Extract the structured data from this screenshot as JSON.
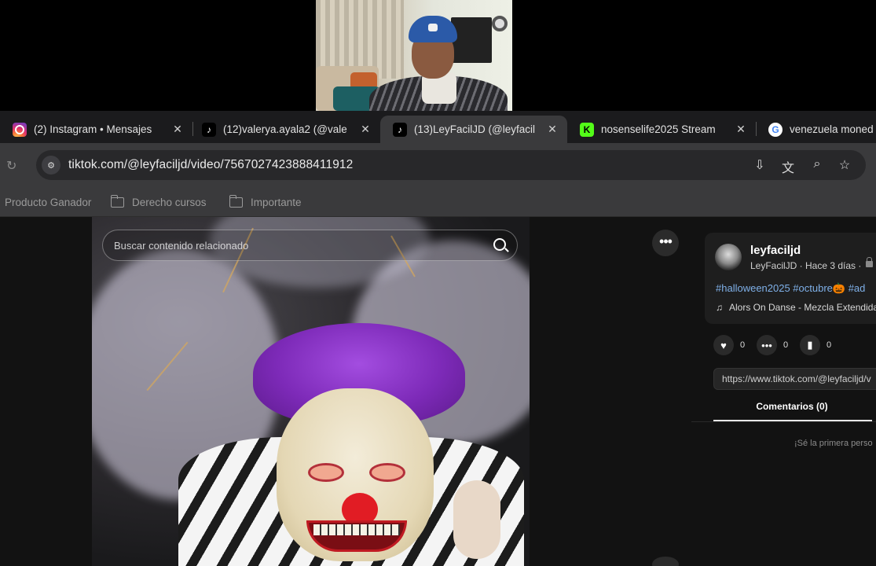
{
  "tabs": [
    {
      "title": "(2) Instagram • Mensajes",
      "favicon": "instagram-icon",
      "active": false
    },
    {
      "title": "(12)valerya.ayala2 (@vale",
      "favicon": "tiktok-icon",
      "active": false
    },
    {
      "title": "(13)LeyFacilJD (@leyfacil",
      "favicon": "tiktok-icon",
      "active": true
    },
    {
      "title": "nosenselife2025 Stream",
      "favicon": "kick-icon",
      "active": false
    },
    {
      "title": "venezuela moned",
      "favicon": "google-icon",
      "active": false
    }
  ],
  "tab_close_glyph": "✕",
  "address_bar": {
    "url": "tiktok.com/@leyfaciljd/video/7567027423888411912"
  },
  "bookmarks": [
    {
      "label": "Producto Ganador",
      "folder": false
    },
    {
      "label": "Derecho cursos",
      "folder": true
    },
    {
      "label": "Importante",
      "folder": true
    }
  ],
  "video": {
    "search_placeholder": "Buscar contenido relacionado"
  },
  "post": {
    "username": "leyfaciljd",
    "subline": "LeyFacilJD · Hace 3 días ·",
    "hashtags": "#halloween2025 #octubre🎃 #ad",
    "music": "Alors On Danse - Mezcla Extendida",
    "likes": "0",
    "comments": "0",
    "saves": "0",
    "share_link": "https://www.tiktok.com/@leyfaciljd/v",
    "comments_tab": "Comentarios (0)",
    "empty_comments": "¡Sé la primera perso"
  },
  "colors": {
    "tab_active": "#3a3a3c",
    "hashtag": "#7fb0e8",
    "tiktok_bg": "#121212"
  }
}
